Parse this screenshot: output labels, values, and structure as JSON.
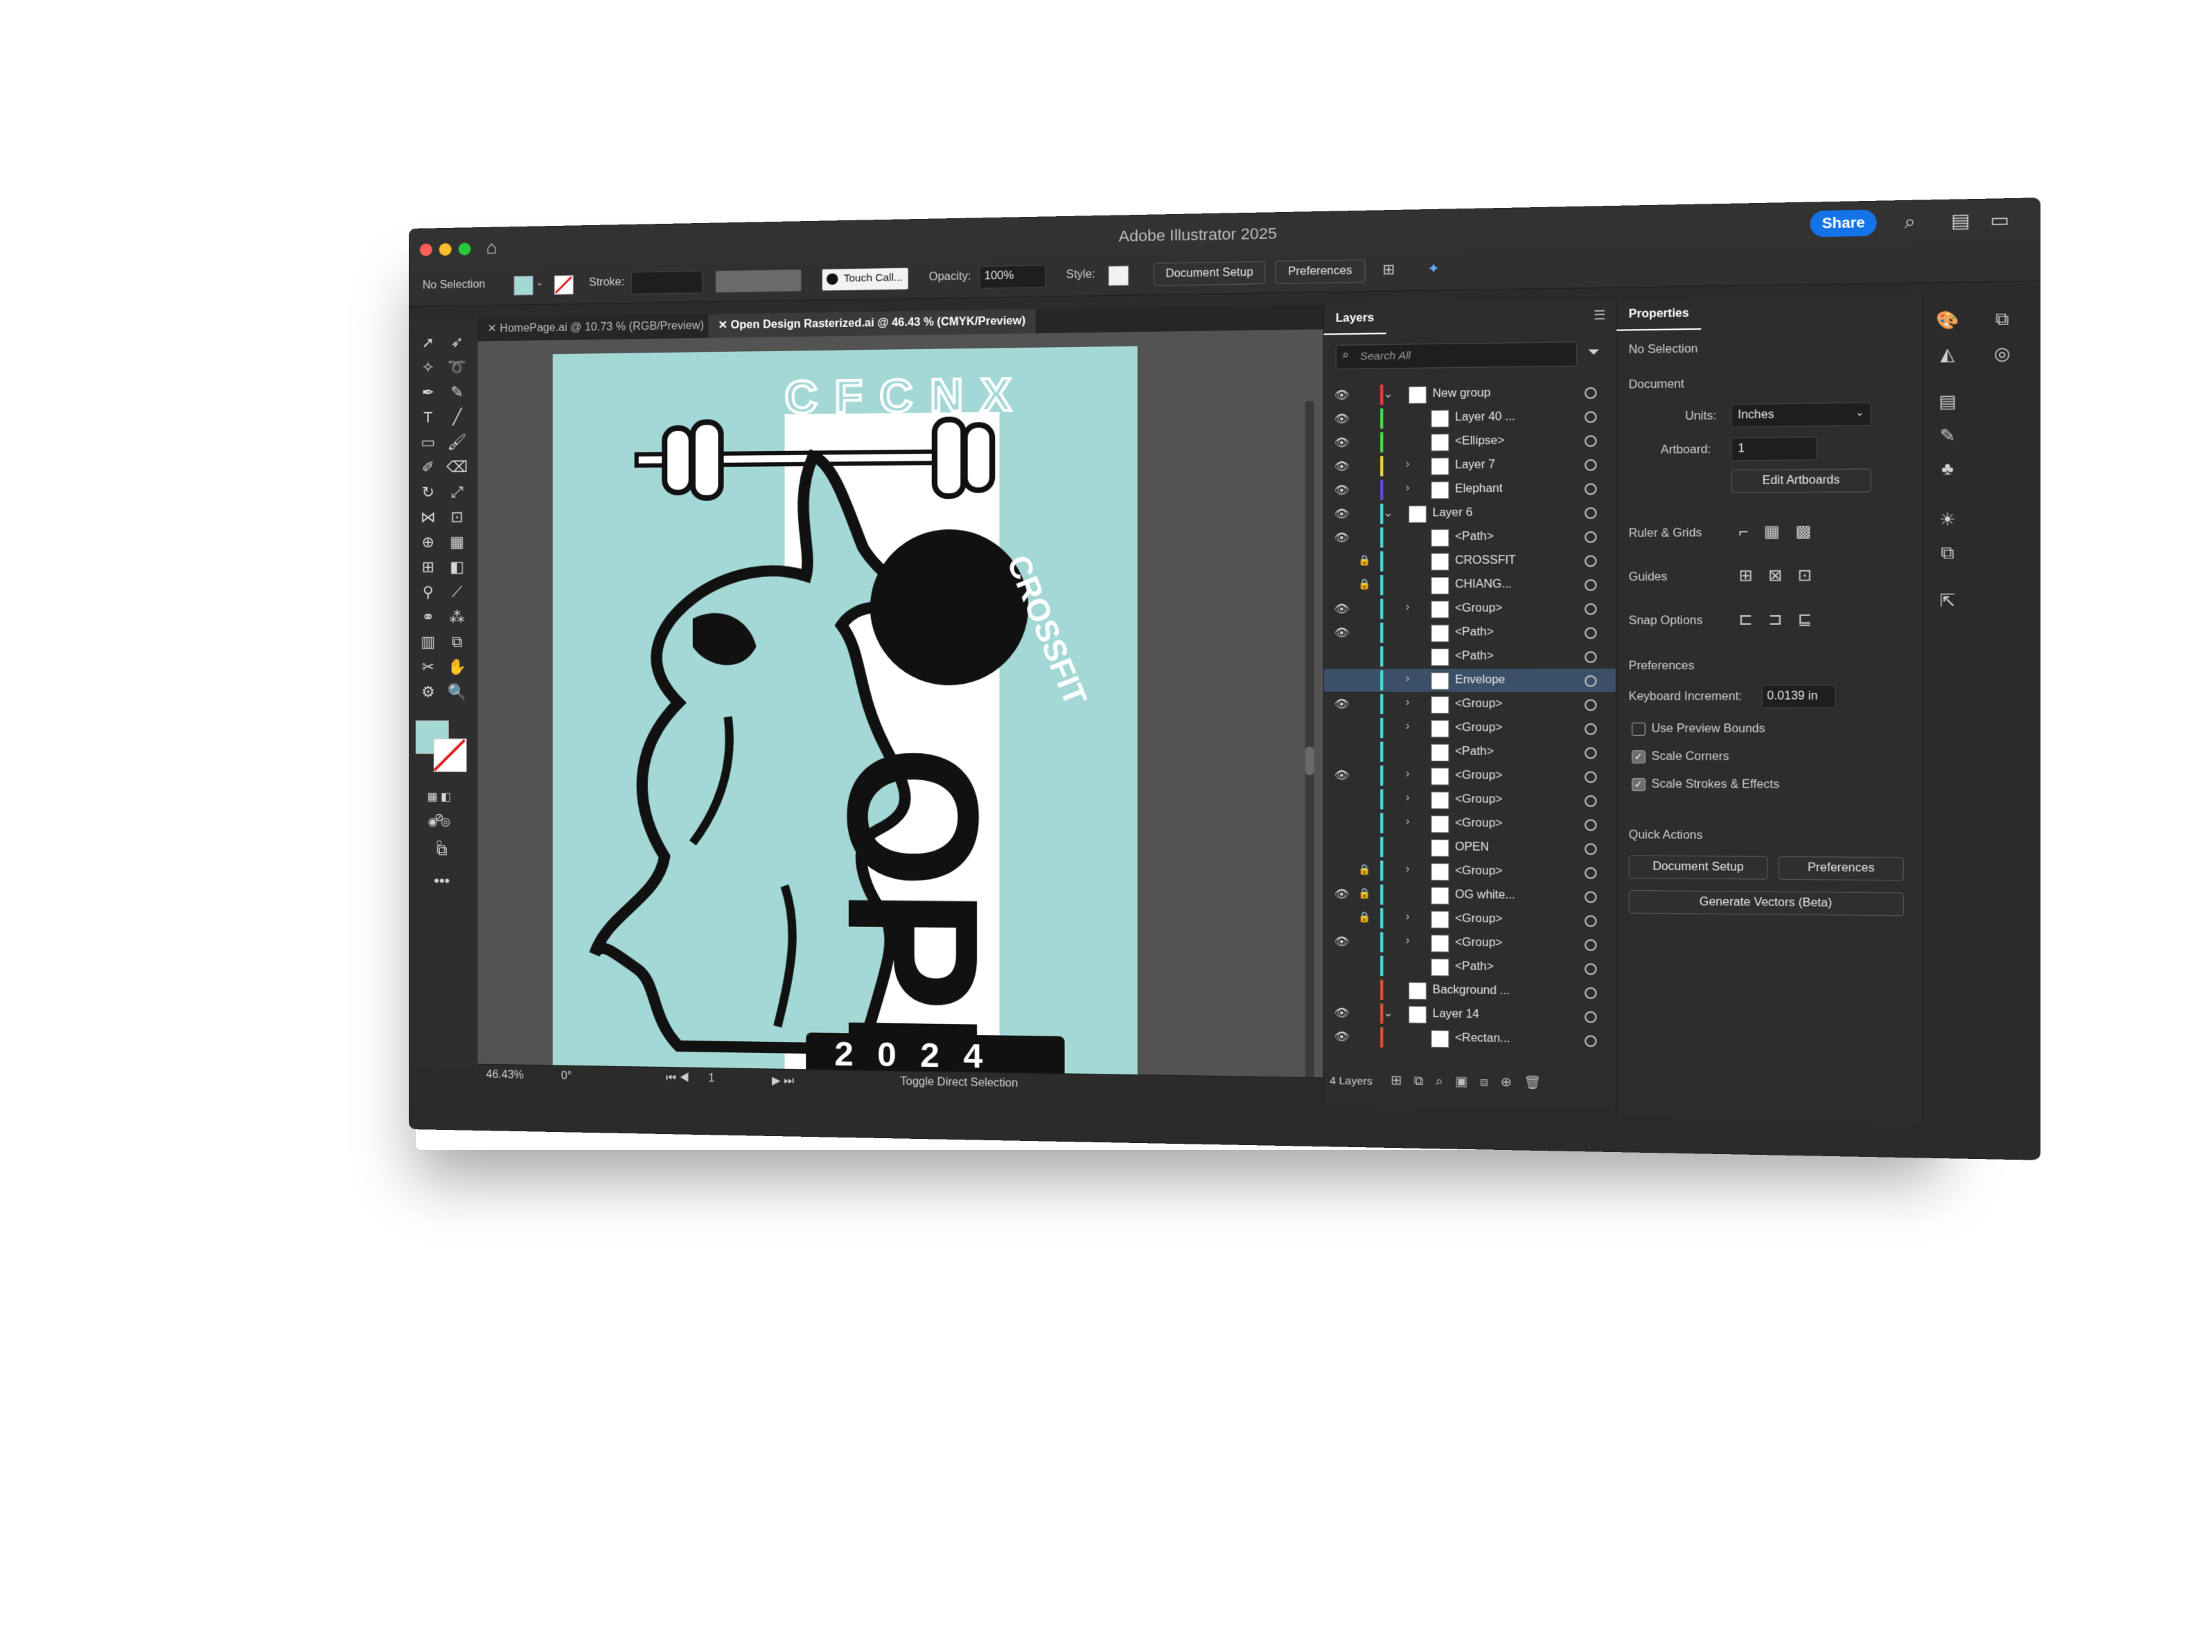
{
  "window": {
    "title": "Adobe Illustrator 2025",
    "share_label": "Share",
    "traffic_colors": [
      "#fe5f57",
      "#febc2e",
      "#28c840"
    ]
  },
  "control_bar": {
    "selection": "No Selection",
    "stroke_label": "Stroke:",
    "brush_label": "Touch Call...",
    "opacity_label": "Opacity:",
    "opacity_value": "100%",
    "style_label": "Style:",
    "document_setup": "Document Setup",
    "preferences": "Preferences",
    "fill_color": "#a3d8d6"
  },
  "tabs": [
    {
      "label": "HomePage.ai @ 10.73 % (RGB/Preview)",
      "active": false
    },
    {
      "label": "Open Design Rasterized.ai @ 46.43 % (CMYK/Preview)",
      "active": true
    }
  ],
  "artwork": {
    "arc_text": "CFCNX",
    "crossfit_text": "CROSSFIT",
    "open_text": "OPEN",
    "year_text": "2 0 2 4",
    "bg_color": "#a3d8d6"
  },
  "status": {
    "zoom": "46.43%",
    "rotation": "0°",
    "artboard_num": "1",
    "tool_hint": "Toggle Direct Selection"
  },
  "layers_panel": {
    "tab": "Layers",
    "search_placeholder": "Search All",
    "footer": "4 Layers",
    "rows": [
      {
        "name": "New group",
        "eye": true,
        "lock": false,
        "color": "#e03c3c",
        "chev": "down",
        "indent": 1
      },
      {
        "name": "Layer 40 ...",
        "eye": true,
        "lock": false,
        "color": "#4fd34f",
        "chev": "",
        "indent": 2
      },
      {
        "name": "<Ellipse>",
        "eye": true,
        "lock": false,
        "color": "#4fd34f",
        "chev": "",
        "indent": 2
      },
      {
        "name": "Layer 7",
        "eye": true,
        "lock": false,
        "color": "#e6d23c",
        "chev": "right",
        "indent": 2
      },
      {
        "name": "Elephant",
        "eye": true,
        "lock": false,
        "color": "#5b4fd3",
        "chev": "right",
        "indent": 2
      },
      {
        "name": "Layer 6",
        "eye": true,
        "lock": false,
        "color": "#4fd3d3",
        "chev": "down",
        "indent": 1
      },
      {
        "name": "<Path>",
        "eye": true,
        "lock": false,
        "color": "#4fd3d3",
        "chev": "",
        "indent": 2
      },
      {
        "name": "CROSSFIT",
        "eye": false,
        "lock": true,
        "color": "#4fd3d3",
        "chev": "",
        "indent": 2
      },
      {
        "name": "CHIANG...",
        "eye": false,
        "lock": true,
        "color": "#4fd3d3",
        "chev": "",
        "indent": 2
      },
      {
        "name": "<Group>",
        "eye": true,
        "lock": false,
        "color": "#4fd3d3",
        "chev": "right",
        "indent": 2
      },
      {
        "name": "<Path>",
        "eye": true,
        "lock": false,
        "color": "#4fd3d3",
        "chev": "",
        "indent": 2
      },
      {
        "name": "<Path>",
        "eye": false,
        "lock": false,
        "color": "#4fd3d3",
        "chev": "",
        "indent": 2
      },
      {
        "name": "Envelope",
        "eye": false,
        "lock": false,
        "color": "#4fd3d3",
        "chev": "right",
        "indent": 2,
        "selected": true
      },
      {
        "name": "<Group>",
        "eye": true,
        "lock": false,
        "color": "#4fd3d3",
        "chev": "right",
        "indent": 2
      },
      {
        "name": "<Group>",
        "eye": false,
        "lock": false,
        "color": "#4fd3d3",
        "chev": "right",
        "indent": 2
      },
      {
        "name": "<Path>",
        "eye": false,
        "lock": false,
        "color": "#4fd3d3",
        "chev": "",
        "indent": 2
      },
      {
        "name": "<Group>",
        "eye": true,
        "lock": false,
        "color": "#4fd3d3",
        "chev": "right",
        "indent": 2
      },
      {
        "name": "<Group>",
        "eye": false,
        "lock": false,
        "color": "#4fd3d3",
        "chev": "right",
        "indent": 2
      },
      {
        "name": "<Group>",
        "eye": false,
        "lock": false,
        "color": "#4fd3d3",
        "chev": "right",
        "indent": 2
      },
      {
        "name": "OPEN",
        "eye": false,
        "lock": false,
        "color": "#4fd3d3",
        "chev": "",
        "indent": 2
      },
      {
        "name": "<Group>",
        "eye": false,
        "lock": true,
        "color": "#4fd3d3",
        "chev": "right",
        "indent": 2
      },
      {
        "name": "OG white...",
        "eye": true,
        "lock": true,
        "color": "#4fd3d3",
        "chev": "",
        "indent": 2
      },
      {
        "name": "<Group>",
        "eye": false,
        "lock": true,
        "color": "#4fd3d3",
        "chev": "right",
        "indent": 2
      },
      {
        "name": "<Group>",
        "eye": true,
        "lock": false,
        "color": "#4fd3d3",
        "chev": "right",
        "indent": 2
      },
      {
        "name": "<Path>",
        "eye": false,
        "lock": false,
        "color": "#4fd3d3",
        "chev": "",
        "indent": 2
      },
      {
        "name": "Background ...",
        "eye": false,
        "lock": false,
        "color": "#d3532f",
        "chev": "",
        "indent": 1
      },
      {
        "name": "Layer 14",
        "eye": true,
        "lock": false,
        "color": "#d3532f",
        "chev": "down",
        "indent": 1
      },
      {
        "name": "<Rectan...",
        "eye": true,
        "lock": false,
        "color": "#d3532f",
        "chev": "",
        "indent": 2
      }
    ]
  },
  "properties_panel": {
    "tab": "Properties",
    "selection": "No Selection",
    "document_heading": "Document",
    "units_label": "Units:",
    "units_value": "Inches",
    "artboard_label": "Artboard:",
    "artboard_value": "1",
    "edit_artboards": "Edit Artboards",
    "ruler_grids": "Ruler & Grids",
    "guides": "Guides",
    "snap_options": "Snap Options",
    "preferences_heading": "Preferences",
    "keyboard_increment_label": "Keyboard Increment:",
    "keyboard_increment_value": "0.0139 in",
    "use_preview_bounds": "Use Preview Bounds",
    "scale_corners": "Scale Corners",
    "scale_strokes": "Scale Strokes & Effects",
    "quick_actions": "Quick Actions",
    "qa_document_setup": "Document Setup",
    "qa_preferences": "Preferences",
    "generate_vectors": "Generate Vectors (Beta)"
  }
}
